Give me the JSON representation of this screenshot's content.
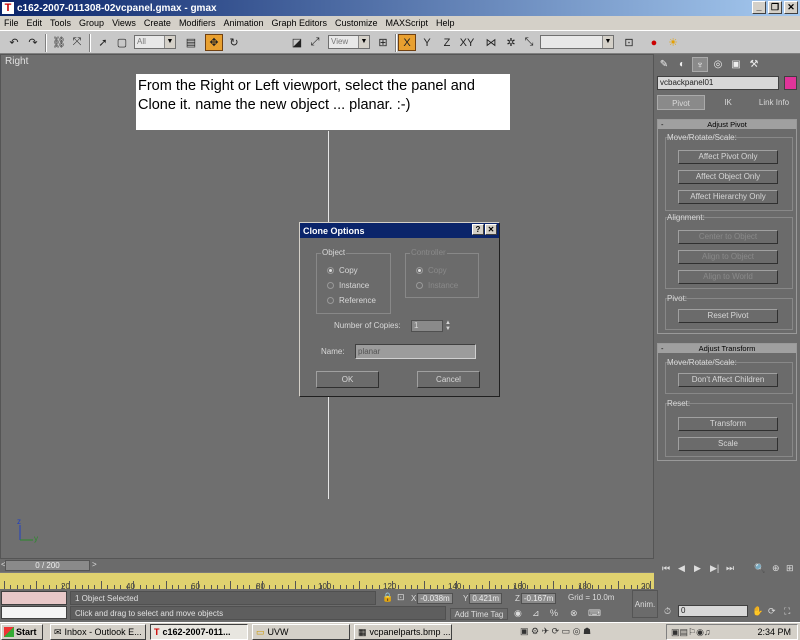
{
  "window": {
    "title": "c162-2007-011308-02vcpanel.gmax - gmax",
    "minimize": "_",
    "restore": "❐",
    "close": "✕"
  },
  "menu": [
    "File",
    "Edit",
    "Tools",
    "Group",
    "Views",
    "Create",
    "Modifiers",
    "Animation",
    "Graph Editors",
    "Customize",
    "MAXScript",
    "Help"
  ],
  "toolbar": {
    "selection_filter": "All",
    "ref_coord": "View",
    "named_selection": ""
  },
  "viewport": {
    "label": "Right",
    "instruction": "From the Right or Left viewport, select the panel and Clone it.  name the new object ... planar. :-)",
    "axis_z": "z",
    "axis_y": "y"
  },
  "clone_dialog": {
    "title": "Clone Options",
    "help": "?",
    "close": "✕",
    "object_group": "Object",
    "object_options": [
      "Copy",
      "Instance",
      "Reference"
    ],
    "object_selected": 0,
    "controller_group": "Controller",
    "controller_options": [
      "Copy",
      "Instance"
    ],
    "copies_label": "Number of Copies:",
    "copies_value": "1",
    "name_label": "Name:",
    "name_value": "planar",
    "ok": "OK",
    "cancel": "Cancel"
  },
  "command_panel": {
    "object_name": "vcbackpanel01",
    "object_color": "#e0349a",
    "subtabs": [
      "Pivot",
      "IK",
      "Link Info"
    ],
    "adjust_pivot": {
      "header": "Adjust Pivot",
      "move_rotate_scale": "Move/Rotate/Scale:",
      "buttons": [
        "Affect Pivot Only",
        "Affect Object Only",
        "Affect Hierarchy Only"
      ],
      "alignment": "Alignment:",
      "align_buttons": [
        "Center to Object",
        "Align to Object",
        "Align to World"
      ],
      "pivot": "Pivot:",
      "reset_pivot": "Reset Pivot"
    },
    "adjust_transform": {
      "header": "Adjust Transform",
      "move_rotate_scale": "Move/Rotate/Scale:",
      "dont_affect": "Don't Affect Children",
      "reset": "Reset:",
      "transform": "Transform",
      "scale": "Scale"
    },
    "collapse": "-"
  },
  "timeline": {
    "slider": "0 / 200",
    "prev": "<",
    "next": ">",
    "ruler_labels": [
      "20",
      "40",
      "60",
      "80",
      "100",
      "120",
      "140",
      "160",
      "180",
      "20"
    ]
  },
  "status": {
    "selected": "1 Object Selected",
    "prompt": "Click and drag to select and move objects",
    "x_label": "X",
    "x_value": "-0.038m",
    "y_label": "Y",
    "y_value": "0.421m",
    "z_label": "Z",
    "z_value": "-0.167m",
    "grid": "Grid = 10.0m",
    "add_time_tag": "Add Time Tag",
    "anim": "Anim.",
    "frame": "0"
  },
  "taskbar": {
    "start": "Start",
    "tasks": [
      "Inbox - Outlook E...",
      "c162-2007-011...",
      "UVW",
      "vcpanelparts.bmp ..."
    ],
    "active_task": 1,
    "clock": "2:34 PM"
  }
}
